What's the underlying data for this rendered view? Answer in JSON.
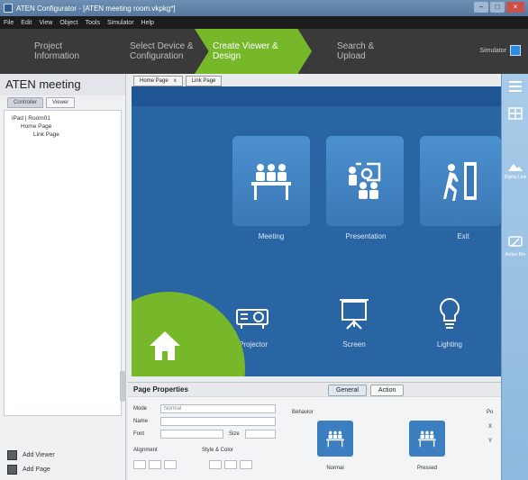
{
  "window": {
    "title": "ATEN Configurator - [ATEN meeting room.vkpkg*]"
  },
  "menu": [
    "File",
    "Edit",
    "View",
    "Object",
    "Tools",
    "Simulator",
    "Help"
  ],
  "steps": [
    {
      "label_line1": "Project",
      "label_line2": "Information"
    },
    {
      "label_line1": "Select Device &",
      "label_line2": "Configuration"
    },
    {
      "label_line1": "Create Viewer &",
      "label_line2": "Design"
    },
    {
      "label_line1": "Search &",
      "label_line2": "Upload"
    }
  ],
  "simulator": {
    "label": "Simulator"
  },
  "sidebar": {
    "project_name": "ATEN meeting",
    "tabs": [
      "Controller",
      "Viewer"
    ],
    "tree": [
      "iPad | Room01",
      "Home Page",
      "Link Page"
    ],
    "add_viewer": "Add Viewer",
    "add_page": "Add Page"
  },
  "page_tabs": [
    {
      "label": "Home Page",
      "close": "x"
    },
    {
      "label": "Link Page"
    }
  ],
  "canvas": {
    "tiles": [
      "Meeting",
      "Presentation",
      "Exit"
    ],
    "devices": [
      "Projector",
      "Screen",
      "Lighting"
    ]
  },
  "properties": {
    "title": "Page Properties",
    "tabs": [
      "General",
      "Action"
    ],
    "mode_label": "Mode",
    "mode_value": "Normal",
    "name_label": "Name",
    "font_label": "Font",
    "size_label": "Size",
    "alignment_label": "Alignment",
    "style_label": "Style & Color",
    "behavior_label": "Behavior",
    "normal_label": "Normal",
    "pressed_label": "Pressed",
    "pos_label": "Po",
    "x_label": "X",
    "y_label": "Y"
  },
  "rightbar": [
    "Digital Link",
    "Action Btn"
  ],
  "colors": {
    "accent_green": "#77b82b",
    "canvas_blue": "#2a65a3",
    "tile_blue": "#4b90cf"
  }
}
